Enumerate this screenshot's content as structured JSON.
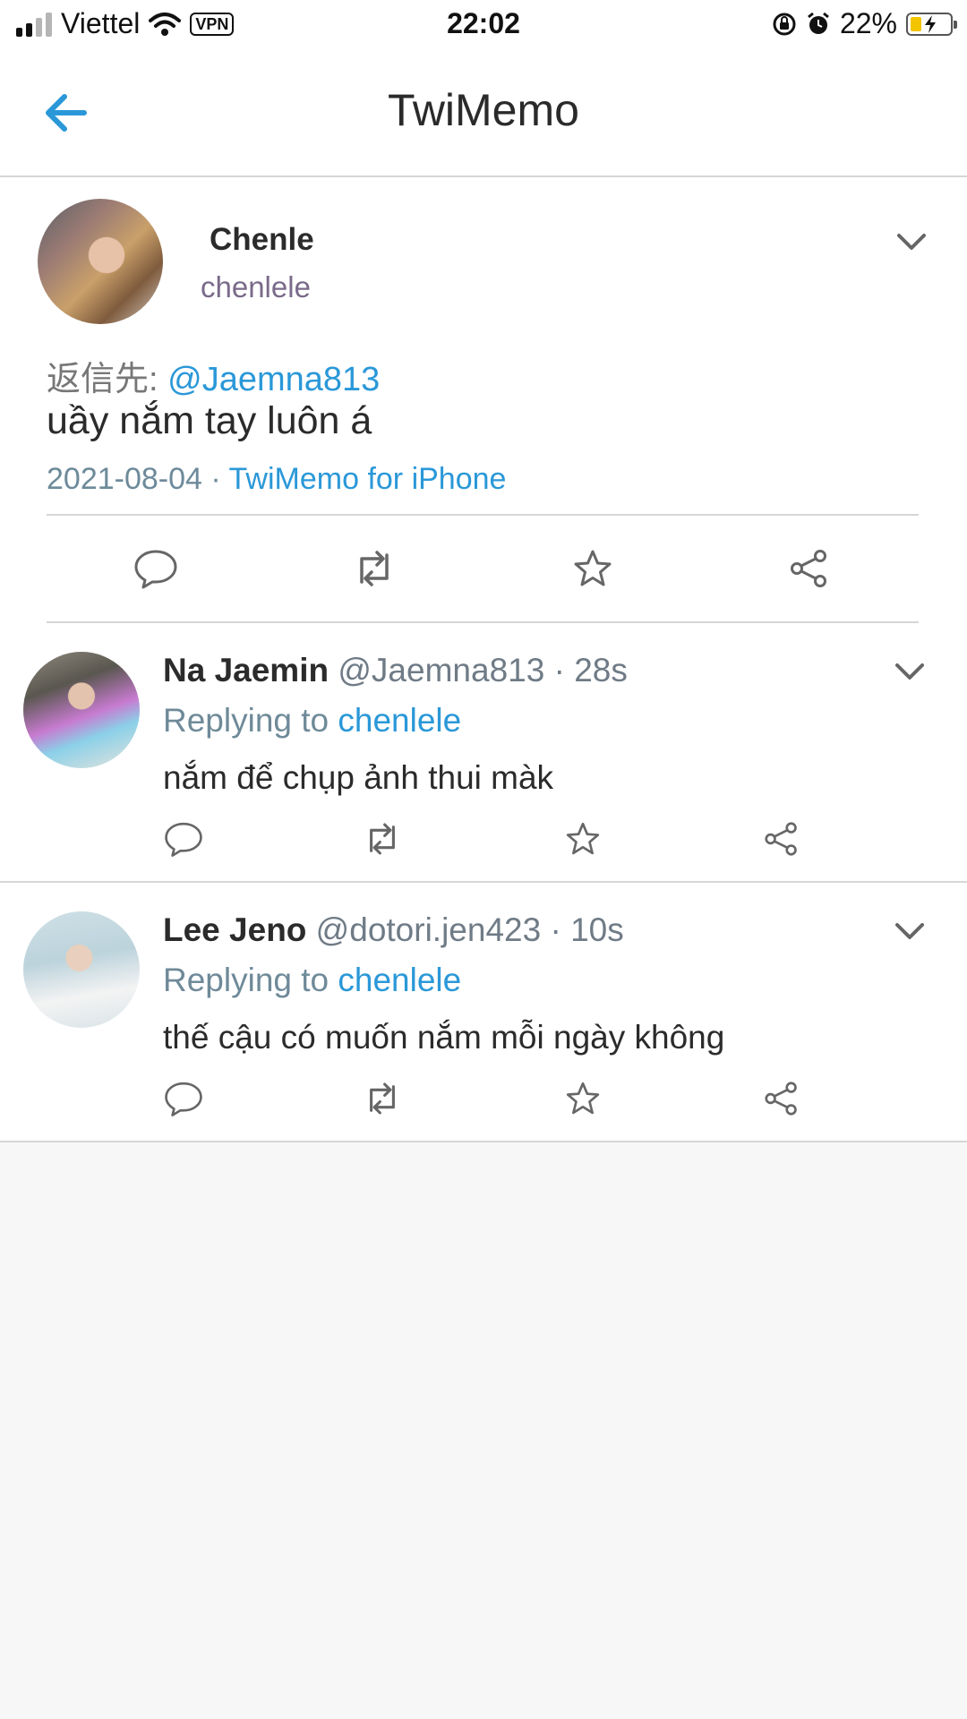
{
  "status_bar": {
    "carrier": "Viettel",
    "vpn": "VPN",
    "time": "22:02",
    "battery_percent": "22%",
    "icons": [
      "signal-icon",
      "wifi-icon",
      "rotation-lock-icon",
      "alarm-icon",
      "battery-charging-icon"
    ]
  },
  "navbar": {
    "title": "TwiMemo",
    "back_icon": "arrow-left-icon",
    "accent_color": "#2a98d8"
  },
  "main_tweet": {
    "name": "Chenle",
    "handle": "chenlele",
    "reply_prefix": "返信先: ",
    "reply_mention": "@Jaemna813",
    "text": "uầy nắm tay luôn á",
    "date": "2021-08-04",
    "separator": " · ",
    "via": "TwiMemo for iPhone"
  },
  "replies": [
    {
      "name": "Na Jaemin",
      "handle": " @Jaemna813",
      "time": " · 28s",
      "replying_prefix": "Replying to ",
      "replying_user": "chenlele",
      "text": "nắm để chụp ảnh thui màk"
    },
    {
      "name": "Lee Jeno",
      "handle": " @dotori.jen423",
      "time": " · 10s",
      "replying_prefix": "Replying to ",
      "replying_user": "chenlele",
      "text": "thế cậu có muốn nắm mỗi ngày không"
    }
  ],
  "action_icons": [
    "reply-icon",
    "retweet-icon",
    "favorite-star-icon",
    "share-icon"
  ]
}
